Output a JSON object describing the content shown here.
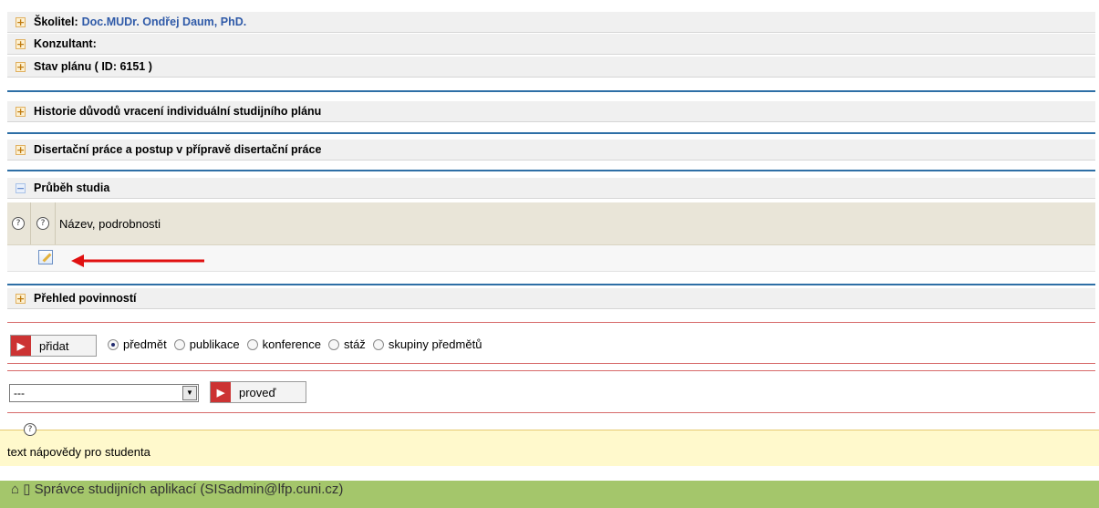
{
  "sections": {
    "skolitel": {
      "label": "Školitel:",
      "value": "Doc.MUDr. Ondřej Daum, PhD."
    },
    "konzultant": {
      "label": "Konzultant:"
    },
    "stav": {
      "label": "Stav plánu ( ID: 6151 )"
    },
    "historie": {
      "label": "Historie důvodů vracení individuální studijního plánu"
    },
    "disertace": {
      "label": "Disertační práce a postup v přípravě disertační práce"
    },
    "prubeh": {
      "label": "Průběh studia"
    },
    "prehled": {
      "label": "Přehled povinností"
    }
  },
  "table": {
    "header": "Název, podrobnosti"
  },
  "toolbar": {
    "add_label": "přidat",
    "radios": [
      "předmět",
      "publikace",
      "konference",
      "stáž",
      "skupiny předmětů"
    ],
    "selected_radio": "předmět"
  },
  "action": {
    "select_value": "---",
    "go_label": "proveď"
  },
  "hint": {
    "text": "text nápovědy pro studenta"
  },
  "footer": {
    "text": "⌂ ▯ Správce studijních aplikací (SISadmin@lfp.cuni.cz)"
  },
  "icons": {
    "plus": "+",
    "minus": "−",
    "help": "?",
    "mark": "▶"
  }
}
